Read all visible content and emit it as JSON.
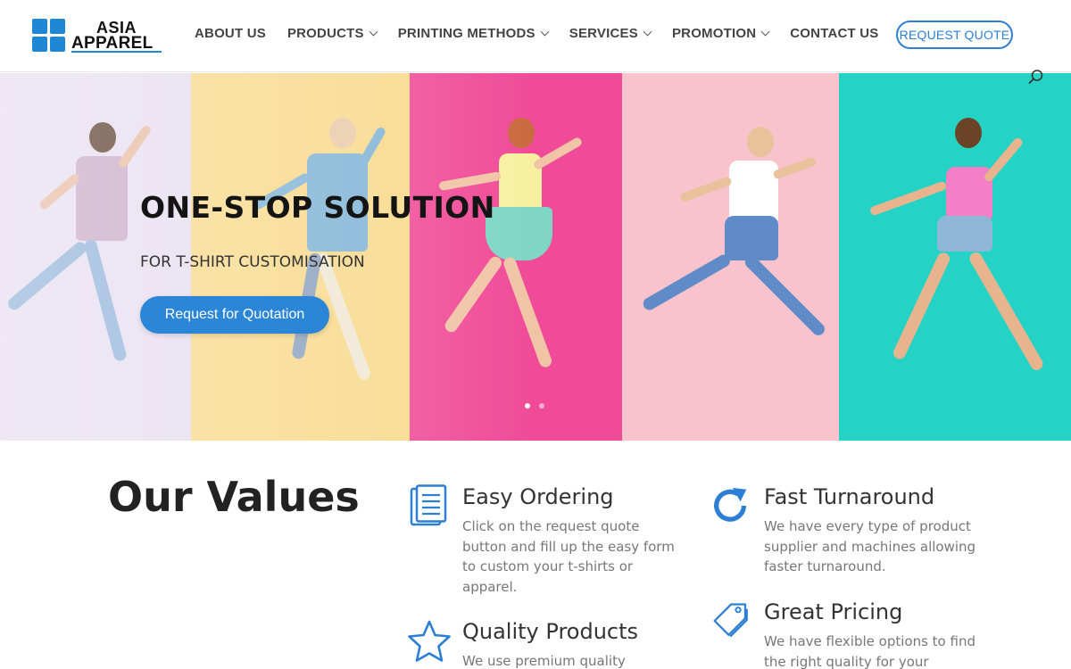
{
  "brand": {
    "name_line1": "ASIA",
    "name_line2": "APPAREL",
    "accent_color": "#1e88d6"
  },
  "nav": {
    "items": [
      {
        "label": "ABOUT US",
        "has_dropdown": false
      },
      {
        "label": "PRODUCTS",
        "has_dropdown": true
      },
      {
        "label": "PRINTING METHODS",
        "has_dropdown": true
      },
      {
        "label": "SERVICES",
        "has_dropdown": true
      },
      {
        "label": "PROMOTION",
        "has_dropdown": true
      },
      {
        "label": "CONTACT US",
        "has_dropdown": false
      }
    ],
    "quote_button": "REQUEST QUOTE",
    "search_icon": "search-icon"
  },
  "hero": {
    "title": "ONE-STOP SOLUTION",
    "subtitle": "FOR T-SHIRT CUSTOMISATION",
    "cta_label": "Request for Quotation",
    "slide_count": 2,
    "active_slide": 1,
    "panel_colors": [
      "#e6dcef",
      "#f8d98a",
      "#f04b98",
      "#f8c3cc",
      "#25d3c6"
    ]
  },
  "values": {
    "heading": "Our Values",
    "items": [
      {
        "icon": "document-icon",
        "title": "Easy Ordering",
        "desc": "Click on the request quote button and fill up the easy form to custom your t-shirts or apparel."
      },
      {
        "icon": "refresh-icon",
        "title": "Fast Turnaround",
        "desc": "We have every type of product supplier and machines allowing faster turnaround."
      },
      {
        "icon": "star-icon",
        "title": "Quality Products",
        "desc": "We use premium quality"
      },
      {
        "icon": "tag-icon",
        "title": "Great Pricing",
        "desc": "We have flexible options to find the right quality for your"
      }
    ]
  }
}
